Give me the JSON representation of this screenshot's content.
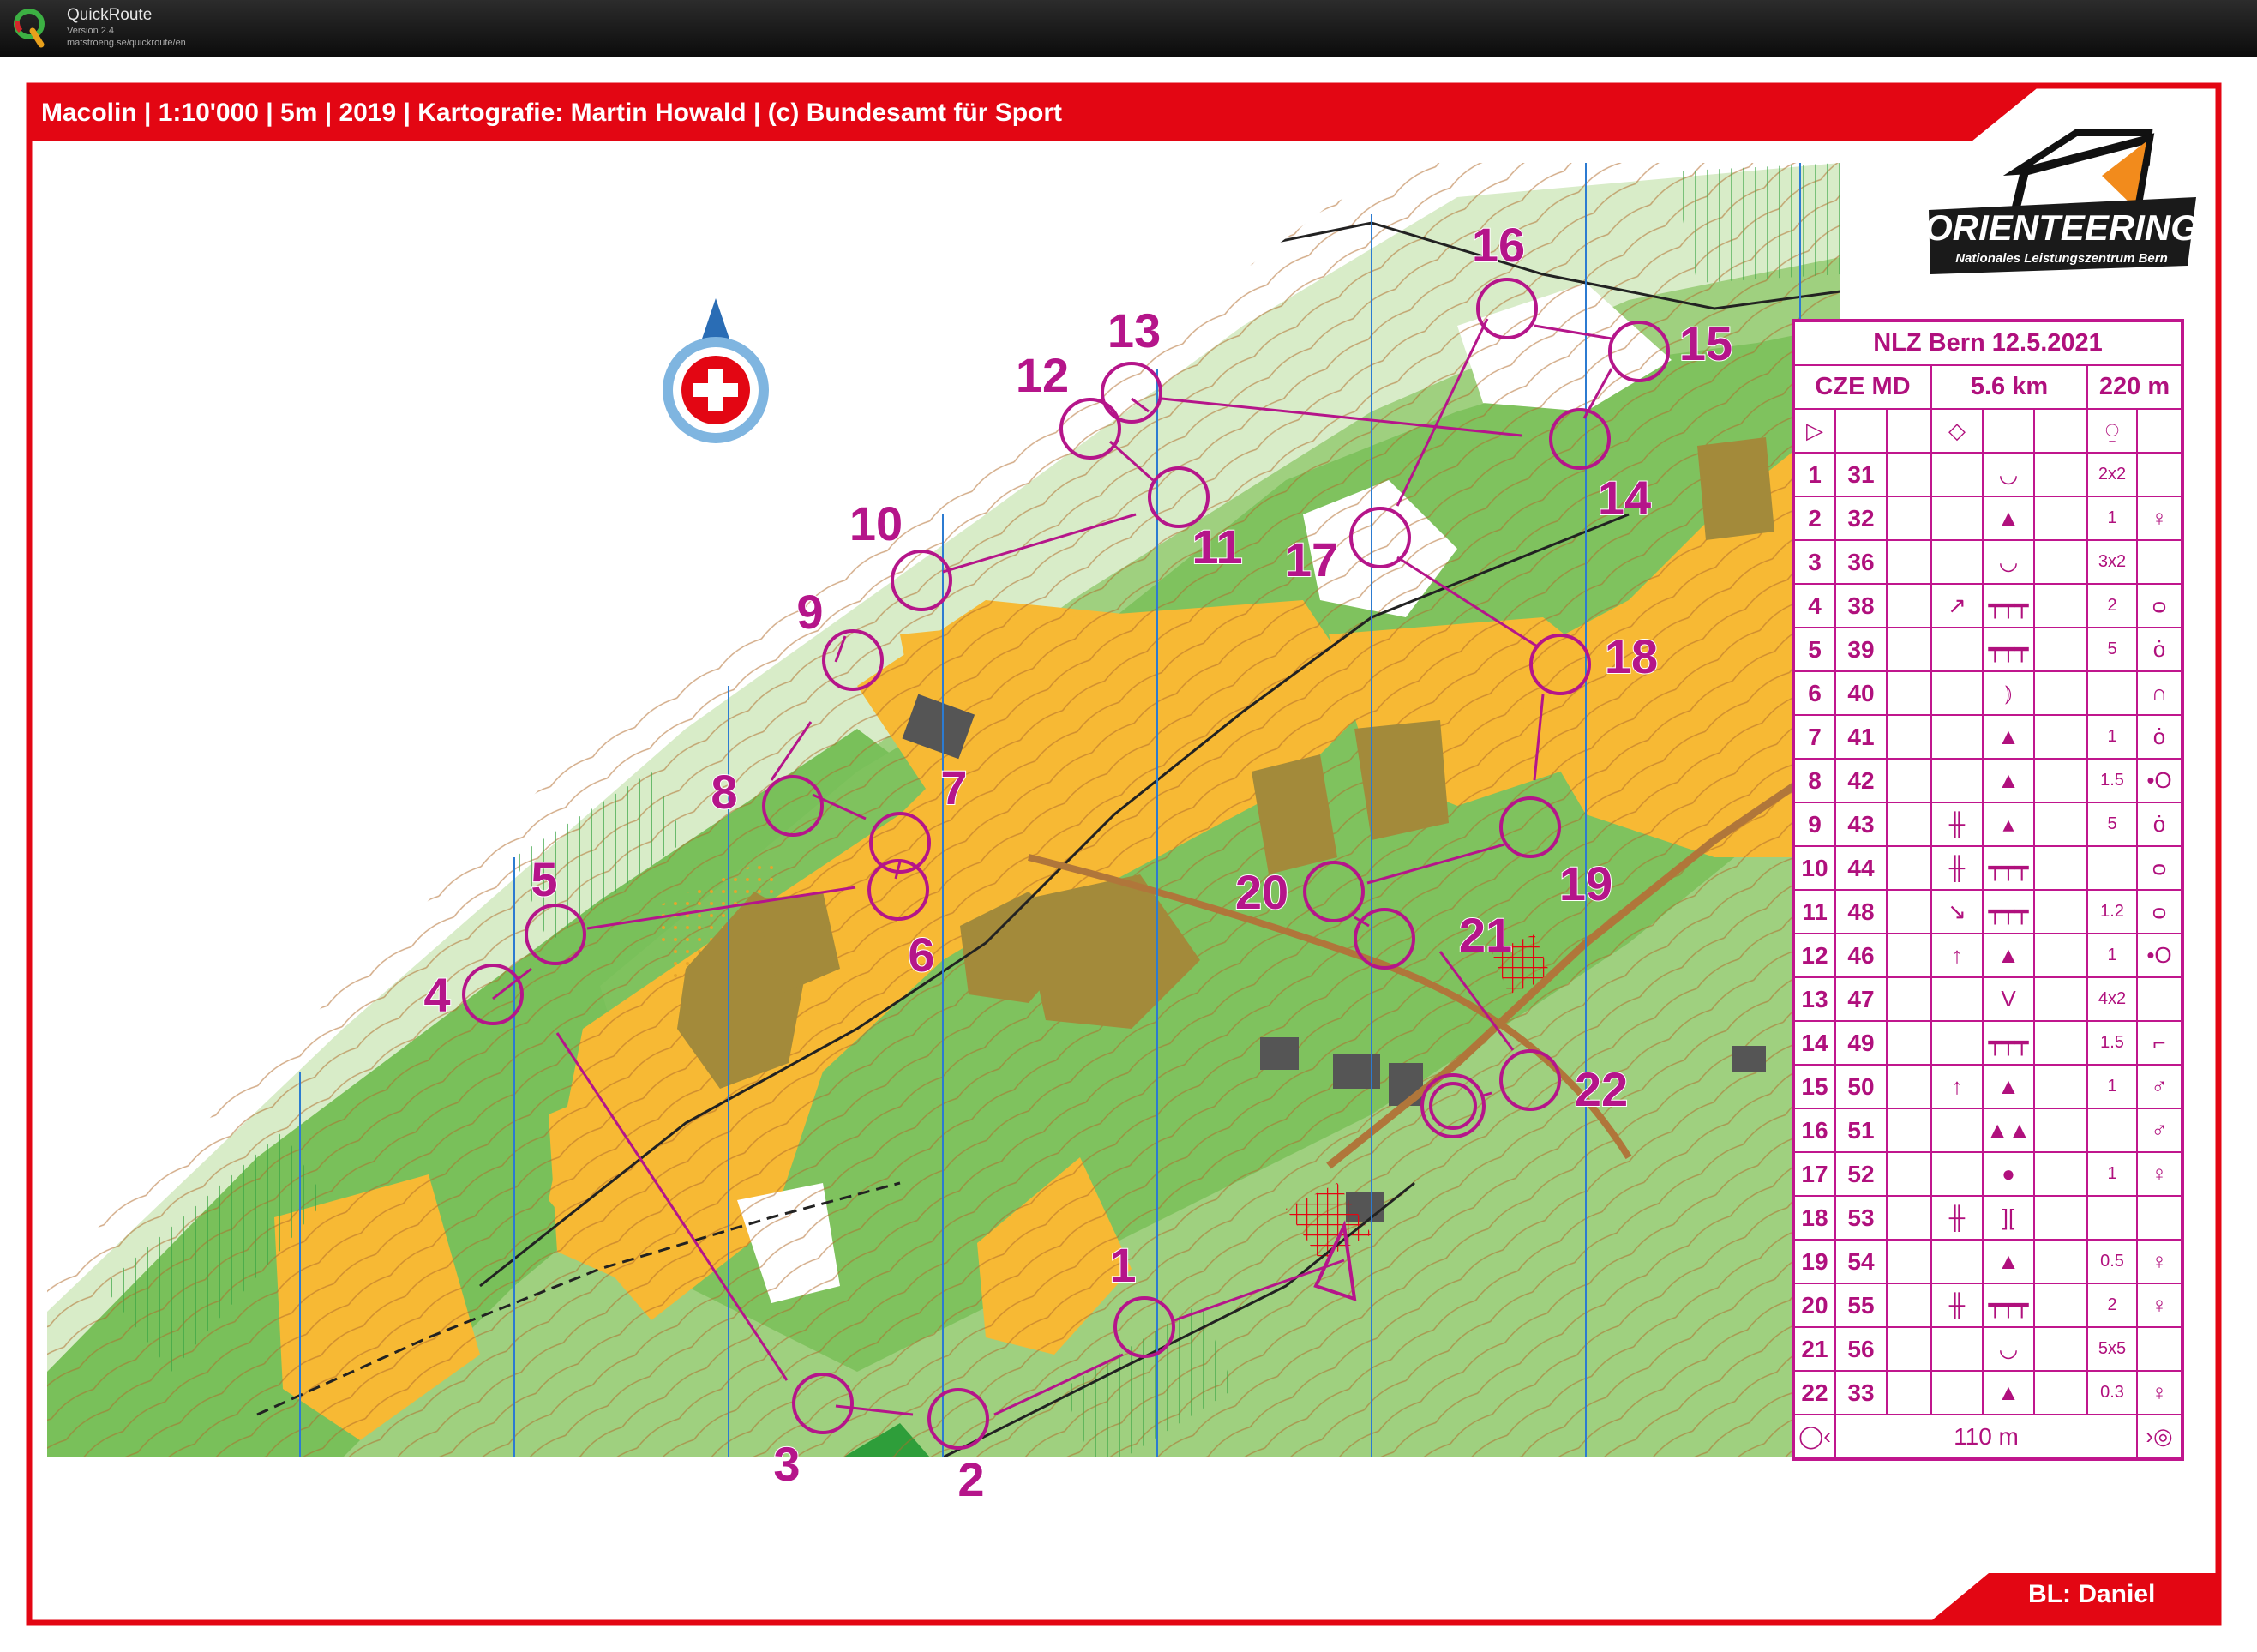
{
  "window": {
    "app_name": "QuickRoute",
    "version": "Version 2.4",
    "url": "matstroeng.se/quickroute/en",
    "logo_glyph": "Q"
  },
  "map": {
    "header": "Macolin | 1:10'000 | 5m | 2019 | Kartografie: Martin Howald | (c) Bundesamt für Sport",
    "footer": "BL: Daniel",
    "logo_text": "ORIENTEERING",
    "logo_subtext": "Nationales Leistungszentrum Bern",
    "colors": {
      "frame": "#e30613",
      "course": "#b5158a",
      "yellow": "#f7b934",
      "green": "#79c05a",
      "dark_green": "#2e9e3a"
    }
  },
  "controls": [
    {
      "label": "1"
    },
    {
      "label": "2"
    },
    {
      "label": "3"
    },
    {
      "label": "4"
    },
    {
      "label": "5"
    },
    {
      "label": "6"
    },
    {
      "label": "7"
    },
    {
      "label": "8"
    },
    {
      "label": "9"
    },
    {
      "label": "10"
    },
    {
      "label": "11"
    },
    {
      "label": "12"
    },
    {
      "label": "13"
    },
    {
      "label": "14"
    },
    {
      "label": "15"
    },
    {
      "label": "16"
    },
    {
      "label": "17"
    },
    {
      "label": "18"
    },
    {
      "label": "19"
    },
    {
      "label": "20"
    },
    {
      "label": "21"
    },
    {
      "label": "22"
    }
  ],
  "descriptions": {
    "title": "NLZ Bern 12.5.2021",
    "class": "CZE MD",
    "length": "5.6 km",
    "climb": "220 m",
    "start_row": {
      "c1": "▷",
      "c4": "◇",
      "c7": "⍜"
    },
    "rows": [
      {
        "n": "1",
        "code": "31",
        "c": "",
        "d": "",
        "e": "◡",
        "f": "",
        "g": "2x2",
        "h": ""
      },
      {
        "n": "2",
        "code": "32",
        "c": "",
        "d": "",
        "e": "▲",
        "f": "",
        "g": "1",
        "h": "♀"
      },
      {
        "n": "3",
        "code": "36",
        "c": "",
        "d": "",
        "e": "◡",
        "f": "",
        "g": "3x2",
        "h": ""
      },
      {
        "n": "4",
        "code": "38",
        "c": "",
        "d": "↗",
        "e": "┯┯┯",
        "f": "",
        "g": "2",
        "h": "ᴑ"
      },
      {
        "n": "5",
        "code": "39",
        "c": "",
        "d": "",
        "e": "┯┯┯",
        "f": "",
        "g": "5",
        "h": "ȯ"
      },
      {
        "n": "6",
        "code": "40",
        "c": "",
        "d": "",
        "e": "⦆",
        "f": "",
        "g": "",
        "h": "∩"
      },
      {
        "n": "7",
        "code": "41",
        "c": "",
        "d": "",
        "e": "▲",
        "f": "",
        "g": "1",
        "h": "ȯ"
      },
      {
        "n": "8",
        "code": "42",
        "c": "",
        "d": "",
        "e": "▲",
        "f": "",
        "g": "1.5",
        "h": "•O"
      },
      {
        "n": "9",
        "code": "43",
        "c": "",
        "d": "╫",
        "e": "▴",
        "f": "",
        "g": "5",
        "h": "ȯ"
      },
      {
        "n": "10",
        "code": "44",
        "c": "",
        "d": "╫",
        "e": "┯┯┯",
        "f": "",
        "g": "",
        "h": "ᴑ"
      },
      {
        "n": "11",
        "code": "48",
        "c": "",
        "d": "↘",
        "e": "┯┯┯",
        "f": "",
        "g": "1.2",
        "h": "ᴑ"
      },
      {
        "n": "12",
        "code": "46",
        "c": "",
        "d": "↑",
        "e": "▲",
        "f": "",
        "g": "1",
        "h": "•O"
      },
      {
        "n": "13",
        "code": "47",
        "c": "",
        "d": "",
        "e": "V",
        "f": "",
        "g": "4x2",
        "h": ""
      },
      {
        "n": "14",
        "code": "49",
        "c": "",
        "d": "",
        "e": "┯┯┯",
        "f": "",
        "g": "1.5",
        "h": "⌐"
      },
      {
        "n": "15",
        "code": "50",
        "c": "",
        "d": "↑",
        "e": "▲",
        "f": "",
        "g": "1",
        "h": "♂"
      },
      {
        "n": "16",
        "code": "51",
        "c": "",
        "d": "",
        "e": "▲▲",
        "f": "",
        "g": "",
        "h": "♂"
      },
      {
        "n": "17",
        "code": "52",
        "c": "",
        "d": "",
        "e": "●",
        "f": "",
        "g": "1",
        "h": "♀"
      },
      {
        "n": "18",
        "code": "53",
        "c": "",
        "d": "╫",
        "e": "][",
        "f": "",
        "g": "",
        "h": ""
      },
      {
        "n": "19",
        "code": "54",
        "c": "",
        "d": "",
        "e": "▲",
        "f": "",
        "g": "0.5",
        "h": "♀"
      },
      {
        "n": "20",
        "code": "55",
        "c": "",
        "d": "╫",
        "e": "┯┯┯",
        "f": "",
        "g": "2",
        "h": "♀"
      },
      {
        "n": "21",
        "code": "56",
        "c": "",
        "d": "",
        "e": "◡",
        "f": "",
        "g": "5x5",
        "h": ""
      },
      {
        "n": "22",
        "code": "33",
        "c": "",
        "d": "",
        "e": "▲",
        "f": "",
        "g": "0.3",
        "h": "♀"
      }
    ],
    "finish_distance": "110 m"
  }
}
